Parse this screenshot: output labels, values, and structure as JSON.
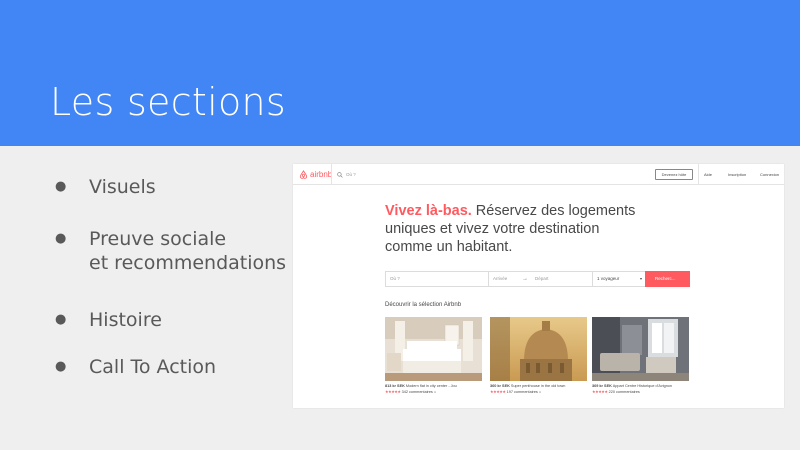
{
  "slide": {
    "title": "Les sections",
    "header_color": "#4285f4",
    "bullets": [
      {
        "marker": "●",
        "lines": [
          "Visuels"
        ]
      },
      {
        "marker": "●",
        "lines": [
          "Preuve sociale",
          "et recommendations"
        ]
      },
      {
        "marker": "●",
        "lines": [
          "Histoire"
        ]
      },
      {
        "marker": "●",
        "lines": [
          "Call To Action"
        ]
      }
    ]
  },
  "screenshot": {
    "nav": {
      "logo_text": "airbnb",
      "logo_icon": "airbnb-logo-icon",
      "search_placeholder": "Où ?",
      "host_button": "Devenez hôte",
      "links": [
        "Aide",
        "Inscription",
        "Connexion"
      ]
    },
    "hero": {
      "accent": "Vivez là-bas.",
      "rest": " Réservez des logements uniques et vivez votre destination comme un habitant."
    },
    "search": {
      "where_placeholder": "Où ?",
      "checkin_placeholder": "Arrivée",
      "checkout_placeholder": "Départ",
      "arrow": "→",
      "guests": "1 voyageur",
      "button": "Recherc..."
    },
    "section_title": "Découvrir la sélection Airbnb",
    "accent_color": "#ff5a5f",
    "listings": [
      {
        "price": "813 kr SEK",
        "name": "Modern flat in city center - Jou",
        "stars": "★★★★★",
        "reviews": "342 commentaires",
        "icon": "house-icon",
        "icon_glyph": "⌂"
      },
      {
        "price": "360 kr SEK",
        "name": "Super penthouse in the old town",
        "stars": "★★★★★",
        "reviews": "197 commentaires",
        "icon": "house-icon",
        "icon_glyph": "⌂"
      },
      {
        "price": "369 kr SEK",
        "name": "Appart Centre Historique d'Avignon",
        "stars": "★★★★★",
        "reviews": "220 commentaires",
        "icon": "",
        "icon_glyph": ""
      }
    ]
  }
}
